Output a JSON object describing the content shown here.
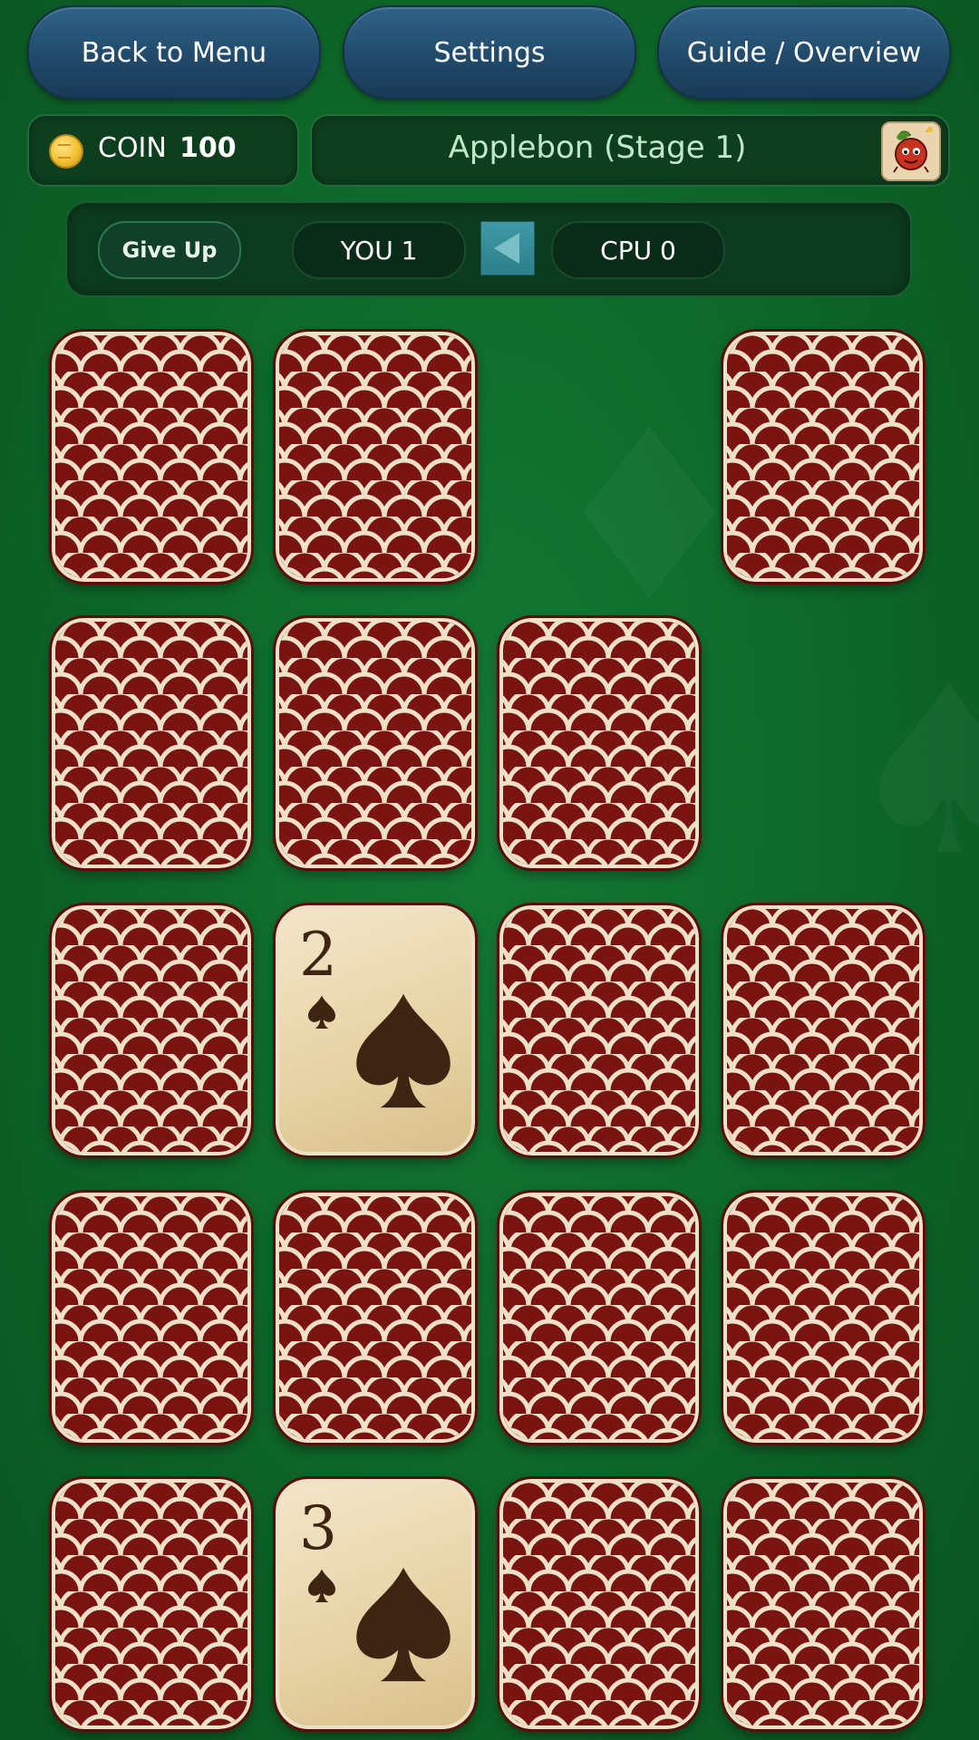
{
  "nav": {
    "back_label": "Back to Menu",
    "settings_label": "Settings",
    "guide_label": "Guide / Overview"
  },
  "status": {
    "coin_label": "COIN",
    "coin_value": "100",
    "stage_title": "Applebon (Stage 1)",
    "opponent_avatar": "apple-character-icon"
  },
  "scoreboard": {
    "give_up_label": "Give Up",
    "you_label": "YOU 1",
    "cpu_label": "CPU 0",
    "turn_indicator": "left-arrow-icon"
  },
  "board": {
    "rows": 5,
    "cols": 4,
    "cards": [
      {
        "state": "back"
      },
      {
        "state": "back"
      },
      {
        "state": "empty"
      },
      {
        "state": "back"
      },
      {
        "state": "back"
      },
      {
        "state": "back"
      },
      {
        "state": "back"
      },
      {
        "state": "empty"
      },
      {
        "state": "back"
      },
      {
        "state": "face",
        "rank": "2",
        "suit": "spade"
      },
      {
        "state": "back"
      },
      {
        "state": "back"
      },
      {
        "state": "back"
      },
      {
        "state": "back"
      },
      {
        "state": "back"
      },
      {
        "state": "back"
      },
      {
        "state": "back"
      },
      {
        "state": "face",
        "rank": "3",
        "suit": "spade"
      },
      {
        "state": "back"
      },
      {
        "state": "back"
      }
    ]
  },
  "colors": {
    "table_green": "#137a34",
    "card_back_red": "#7a1411",
    "card_back_pattern": "#efe0c8",
    "card_face": "#e6d2a4",
    "button_blue": "#214a6b"
  }
}
